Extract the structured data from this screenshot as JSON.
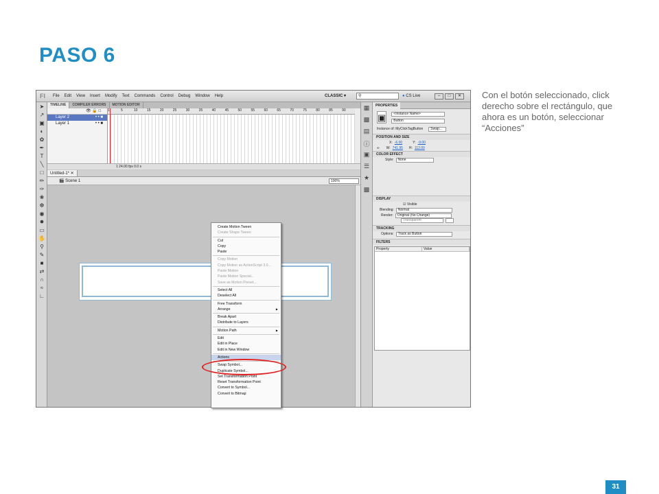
{
  "slide": {
    "title": "PASO 6",
    "caption": "Con el botón seleccionado, click derecho sobre el rectángulo, que ahora es un botón, seleccionar “Acciones”",
    "page_number": "31"
  },
  "app": {
    "logo": "Fl",
    "menu": [
      "File",
      "Edit",
      "View",
      "Insert",
      "Modify",
      "Text",
      "Commands",
      "Control",
      "Debug",
      "Window",
      "Help"
    ],
    "workspace": "CLASSIC ▾",
    "cslive": "CS Live",
    "win_buttons": [
      "–",
      "□",
      "✕"
    ]
  },
  "timeline": {
    "tabs": [
      "TIMELINE",
      "COMPILER ERRORS",
      "MOTION EDITOR"
    ],
    "ruler": [
      "1",
      "5",
      "10",
      "15",
      "20",
      "25",
      "30",
      "35",
      "40",
      "45",
      "50",
      "55",
      "60",
      "65",
      "70",
      "75",
      "80",
      "85",
      "90"
    ],
    "layers": [
      {
        "name": "Layer 2",
        "selected": true
      },
      {
        "name": "Layer 1",
        "selected": false
      }
    ],
    "status": "1   24.00 fps   0.0 s"
  },
  "stage": {
    "doc_tab": "Untitled-1* ✕",
    "scene": "Scene 1",
    "zoom": "100%"
  },
  "context_menu": [
    {
      "label": "Create Motion Tween",
      "disabled": false
    },
    {
      "label": "Create Shape Tween",
      "disabled": true
    },
    {
      "sep": true
    },
    {
      "label": "Cut",
      "disabled": false
    },
    {
      "label": "Copy",
      "disabled": false
    },
    {
      "label": "Paste",
      "disabled": false
    },
    {
      "sep": true
    },
    {
      "label": "Copy Motion",
      "disabled": true
    },
    {
      "label": "Copy Motion as ActionScript 3.0...",
      "disabled": true
    },
    {
      "label": "Paste Motion",
      "disabled": true
    },
    {
      "label": "Paste Motion Special...",
      "disabled": true
    },
    {
      "label": "Save as Motion Preset...",
      "disabled": true
    },
    {
      "sep": true
    },
    {
      "label": "Select All",
      "disabled": false
    },
    {
      "label": "Deselect All",
      "disabled": false
    },
    {
      "sep": true
    },
    {
      "label": "Free Transform",
      "disabled": false
    },
    {
      "label": "Arrange",
      "disabled": false,
      "submenu": true
    },
    {
      "sep": true
    },
    {
      "label": "Break Apart",
      "disabled": false
    },
    {
      "label": "Distribute to Layers",
      "disabled": false
    },
    {
      "sep": true
    },
    {
      "label": "Motion Path",
      "disabled": false,
      "submenu": true
    },
    {
      "sep": true
    },
    {
      "label": "Edit",
      "disabled": false
    },
    {
      "label": "Edit in Place",
      "disabled": false
    },
    {
      "label": "Edit in New Window",
      "disabled": false
    },
    {
      "sep": true
    },
    {
      "label": "Actions",
      "disabled": false,
      "highlight": true
    },
    {
      "sep": true
    },
    {
      "label": "Swap Symbol...",
      "disabled": false
    },
    {
      "label": "Duplicate Symbol...",
      "disabled": false
    },
    {
      "label": "Set Transformation Point",
      "disabled": false
    },
    {
      "label": "Reset Transformation Point",
      "disabled": false
    },
    {
      "label": "Convert to Symbol...",
      "disabled": false
    },
    {
      "label": "Convert to Bitmap",
      "disabled": false
    }
  ],
  "properties": {
    "tab": "PROPERTIES",
    "instance_name_placeholder": "<Instance Name>",
    "symbol_type": "Button",
    "instance_of_label": "Instance of:",
    "instance_of_value": "MyClickTagButton",
    "swap": "Swap...",
    "pos_size_header": "POSITION AND SIZE",
    "x_label": "X:",
    "x": "-6.00",
    "y_label": "Y:",
    "y": "-9.00",
    "w_label": "W:",
    "w": "741.95",
    "h_label": "H:",
    "h": "112.00",
    "color_effect_header": "COLOR EFFECT",
    "style_label": "Style:",
    "style": "None",
    "display_header": "DISPLAY",
    "visible_label": "Visible",
    "blending_label": "Blending:",
    "blending": "Normal",
    "render_label": "Render:",
    "render": "Original (No Change)",
    "render_bg": "Transparent",
    "tracking_header": "TRACKING",
    "options_label": "Options:",
    "options": "Track as Button",
    "filters_header": "FILTERS",
    "filter_cols": [
      "Property",
      "Value"
    ]
  }
}
